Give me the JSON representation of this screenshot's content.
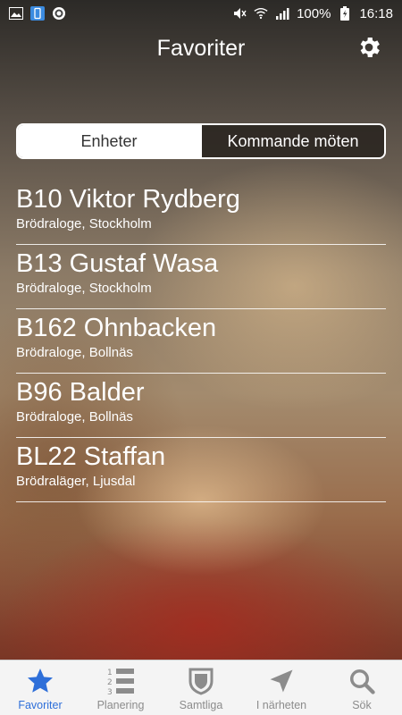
{
  "status_bar": {
    "battery_text": "100%",
    "time": "16:18"
  },
  "header": {
    "title": "Favoriter"
  },
  "segments": [
    {
      "label": "Enheter",
      "active": true
    },
    {
      "label": "Kommande möten",
      "active": false
    }
  ],
  "items": [
    {
      "title": "B10 Viktor Rydberg",
      "subtitle": "Brödraloge, Stockholm"
    },
    {
      "title": "B13 Gustaf Wasa",
      "subtitle": "Brödraloge, Stockholm"
    },
    {
      "title": "B162 Ohnbacken",
      "subtitle": "Brödraloge, Bollnäs"
    },
    {
      "title": "B96 Balder",
      "subtitle": "Brödraloge, Bollnäs"
    },
    {
      "title": "BL22 Staffan",
      "subtitle": "Brödraläger, Ljusdal"
    }
  ],
  "tabs": [
    {
      "label": "Favoriter",
      "icon": "star-icon",
      "active": true
    },
    {
      "label": "Planering",
      "icon": "numbered-list-icon",
      "active": false
    },
    {
      "label": "Samtliga",
      "icon": "shield-icon",
      "active": false
    },
    {
      "label": "I närheten",
      "icon": "location-arrow-icon",
      "active": false
    },
    {
      "label": "Sök",
      "icon": "search-icon",
      "active": false
    }
  ],
  "colors": {
    "active_tab": "#2e6fd9",
    "inactive_tab": "#8c8c8c"
  }
}
